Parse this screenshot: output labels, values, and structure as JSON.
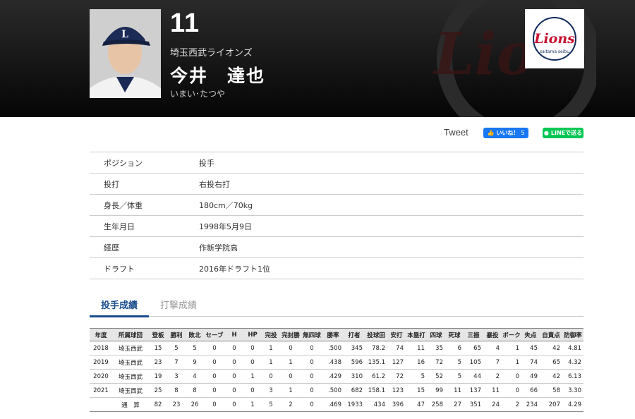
{
  "player": {
    "number": "11",
    "team": "埼玉西武ライオンズ",
    "name": "今井　達也",
    "kana": "いまい･たつや"
  },
  "share": {
    "tweet_label": "Tweet",
    "fb_label": "いいね！",
    "fb_count": "5",
    "line_label": "LINEで送る"
  },
  "profile": [
    {
      "label": "ポジション",
      "value": "投手"
    },
    {
      "label": "投打",
      "value": "右投右打"
    },
    {
      "label": "身長／体重",
      "value": "180cm／70kg"
    },
    {
      "label": "生年月日",
      "value": "1998年5月9日"
    },
    {
      "label": "経歴",
      "value": "作新学院高"
    },
    {
      "label": "ドラフト",
      "value": "2016年ドラフト1位"
    }
  ],
  "tabs": {
    "pitching": "投手成績",
    "batting": "打撃成績"
  },
  "stats": {
    "headers": [
      "年度",
      "所属球団",
      "登板",
      "勝利",
      "敗北",
      "セーブ",
      "H",
      "HP",
      "完投",
      "完封勝",
      "無四球",
      "勝率",
      "打者",
      "投球回",
      "安打",
      "本塁打",
      "四球",
      "死球",
      "三振",
      "暴投",
      "ボーク",
      "失点",
      "自責点",
      "防御率"
    ],
    "rows": [
      [
        "2018",
        "埼玉西武",
        "15",
        "5",
        "5",
        "0",
        "0",
        "0",
        "1",
        "0",
        "0",
        ".500",
        "345",
        "78.2",
        "74",
        "11",
        "35",
        "6",
        "65",
        "4",
        "1",
        "45",
        "42",
        "4.81"
      ],
      [
        "2019",
        "埼玉西武",
        "23",
        "7",
        "9",
        "0",
        "0",
        "0",
        "1",
        "1",
        "0",
        ".438",
        "596",
        "135.1",
        "127",
        "16",
        "72",
        "5",
        "105",
        "7",
        "1",
        "74",
        "65",
        "4.32"
      ],
      [
        "2020",
        "埼玉西武",
        "19",
        "3",
        "4",
        "0",
        "0",
        "1",
        "0",
        "0",
        "0",
        ".429",
        "310",
        "61.2",
        "72",
        "5",
        "52",
        "5",
        "44",
        "2",
        "0",
        "49",
        "42",
        "6.13"
      ],
      [
        "2021",
        "埼玉西武",
        "25",
        "8",
        "8",
        "0",
        "0",
        "0",
        "3",
        "1",
        "0",
        ".500",
        "682",
        "158.1",
        "123",
        "15",
        "99",
        "11",
        "137",
        "11",
        "0",
        "66",
        "58",
        "3.30"
      ]
    ],
    "total": [
      "",
      "通　算",
      "82",
      "23",
      "26",
      "0",
      "0",
      "1",
      "5",
      "2",
      "0",
      ".469",
      "1933",
      "434",
      "396",
      "47",
      "258",
      "27",
      "351",
      "24",
      "2",
      "234",
      "207",
      "4.29"
    ]
  },
  "colors": {
    "accent": "#1a4c8c",
    "facebook": "#1877f2",
    "line": "#06c755",
    "logo_red": "#c8102e",
    "logo_navy": "#102a5c"
  }
}
